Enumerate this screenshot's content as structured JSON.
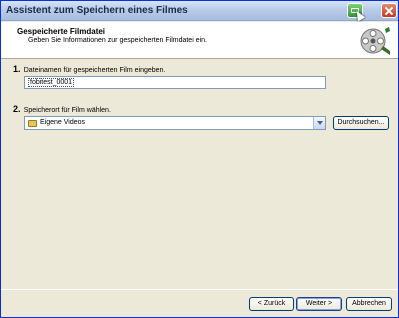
{
  "window": {
    "title": "Assistent zum Speichern eines Filmes"
  },
  "header": {
    "title": "Gespeicherte Filmdatei",
    "subtitle": "Geben Sie Informationen zur gespeicherten Filmdatei ein."
  },
  "step1": {
    "number": "1.",
    "label": "Dateinamen für gespeicherten Film eingeben.",
    "value": "fobitest_0001"
  },
  "step2": {
    "number": "2.",
    "label": "Speicherort für Film wählen.",
    "selected": "Eigene Videos",
    "browse_label": "Durchsuchen..."
  },
  "footer": {
    "back_label": "< Zurück",
    "next_label": "Weiter >",
    "cancel_label": "Abbrechen"
  },
  "icons": [
    "help-icon",
    "close-icon",
    "film-reel-icon",
    "folder-icon",
    "dropdown-arrow-icon"
  ]
}
